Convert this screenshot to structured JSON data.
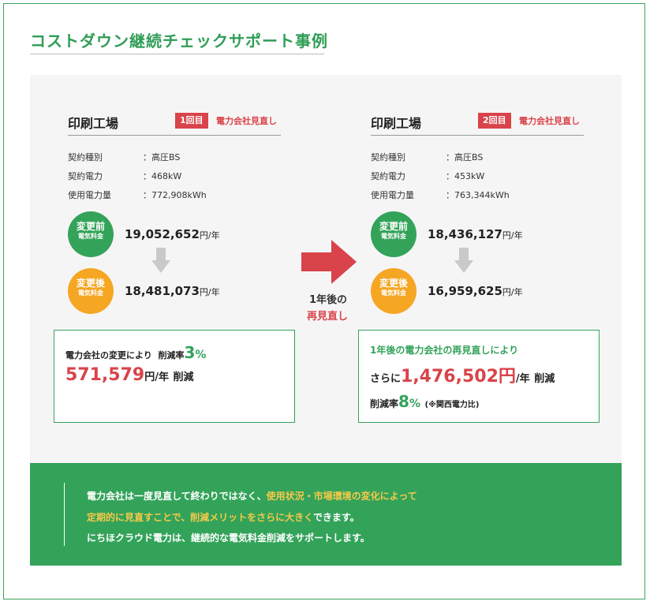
{
  "title": "コストダウン継続チェックサポート事例",
  "case1": {
    "name": "印刷工場",
    "badge": "1回目",
    "badge_text": "電力会社見直し",
    "specs": [
      {
        "label": "契約種別",
        "value": "：高圧BS"
      },
      {
        "label": "契約電力",
        "value": "：468kW"
      },
      {
        "label": "使用電力量",
        "value": "：772,908kWh"
      }
    ],
    "before": {
      "title": "変更前",
      "sub": "電気料金",
      "amount": "19,052,652",
      "unit": "円/年"
    },
    "after": {
      "title": "変更後",
      "sub": "電気料金",
      "amount": "18,481,073",
      "unit": "円/年"
    },
    "result": {
      "line1_a": "電力会社の変更により",
      "line1_b": "削減率",
      "rate": "3",
      "pct": "%",
      "saving": "571,579",
      "saving_unit": "円/年",
      "saving_suffix": "削減"
    }
  },
  "middle": {
    "line1": "1年後の",
    "line2": "再見直し",
    "arrow_color": "#d9434a"
  },
  "case2": {
    "name": "印刷工場",
    "badge": "2回目",
    "badge_text": "電力会社見直し",
    "specs": [
      {
        "label": "契約種別",
        "value": "：高圧BS"
      },
      {
        "label": "契約電力",
        "value": "：453kW"
      },
      {
        "label": "使用電力量",
        "value": "：763,344kWh"
      }
    ],
    "before": {
      "title": "変更前",
      "sub": "電気料金",
      "amount": "18,436,127",
      "unit": "円/年"
    },
    "after": {
      "title": "変更後",
      "sub": "電気料金",
      "amount": "16,959,625",
      "unit": "円/年"
    },
    "result": {
      "line1": "1年後の電力会社の再見直しにより",
      "line2_a": "さらに",
      "saving": "1,476,502円",
      "saving_unit": "/年",
      "saving_suffix": "削減",
      "line3_a": "削減率",
      "rate": "8",
      "pct": "%",
      "note": "(※関西電力比)"
    }
  },
  "footer": {
    "l1_a": "電力会社は一度見直して終わりではなく、",
    "l1_b": "使用状況・市場環境の変化によって",
    "l2_a": "定期的に見直すことで、削減メリットをさらに大きく",
    "l2_b": "できます。",
    "l3": "にちほクラウド電力は、継続的な電気料金削減をサポートします。"
  },
  "colors": {
    "green": "#33a35a",
    "orange": "#f5a623",
    "red": "#d9434a",
    "panel": "#f6f5f5",
    "highlight": "#f7c948"
  }
}
